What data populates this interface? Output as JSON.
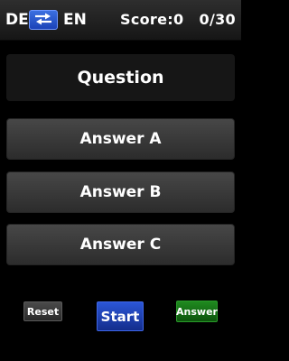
{
  "header": {
    "lang_from": "DE",
    "lang_to": "EN",
    "swap_icon": "swap-arrows-icon",
    "score_text": "Score:0",
    "progress_text": "0/30",
    "swap_button_color": "#2a5ad0"
  },
  "quiz": {
    "question": "Question",
    "answers": [
      "Answer A",
      "Answer B",
      "Answer C"
    ]
  },
  "controls": {
    "reset_label": "Reset",
    "start_label": "Start",
    "answer_label": "Answer",
    "start_color": "#1f3fb0",
    "answer_color": "#177017"
  }
}
